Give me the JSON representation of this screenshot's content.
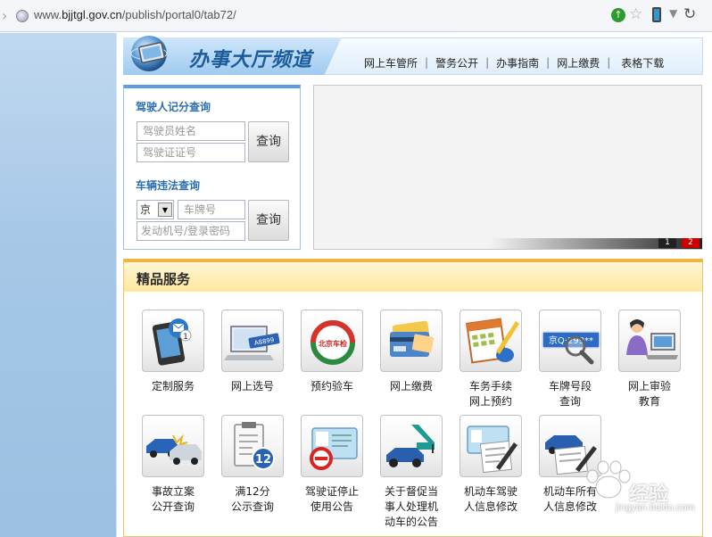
{
  "browser": {
    "url_prefix": "www.",
    "url_domain": "bjjtgl.gov.cn",
    "url_path": "/publish/portal0/tab72/"
  },
  "header": {
    "title": "办事大厅频道",
    "nav": [
      "网上车管所",
      "警务公开",
      "办事指南",
      "网上缴费",
      "表格下载"
    ]
  },
  "driver_query": {
    "title": "驾驶人记分查询",
    "name_placeholder": "驾驶员姓名",
    "license_placeholder": "驾驶证证号",
    "button": "查询"
  },
  "vehicle_query": {
    "title": "车辆违法查询",
    "region_selected": "京",
    "plate_placeholder": "车牌号",
    "engine_placeholder": "发动机号/登录密码",
    "button": "查询"
  },
  "banner": {
    "pages": [
      "1",
      "2"
    ],
    "current_page": 2
  },
  "services": {
    "title": "精品服务",
    "items": [
      {
        "label": "定制服务",
        "icon": "phone-mail-icon"
      },
      {
        "label": "网上选号",
        "icon": "laptop-plate-icon"
      },
      {
        "label": "预约验车",
        "icon": "inspection-stamp-icon"
      },
      {
        "label": "网上缴费",
        "icon": "bank-cards-icon"
      },
      {
        "label": "车务手续\n网上预约",
        "icon": "calendar-pen-icon"
      },
      {
        "label": "车牌号段\n查询",
        "icon": "plate-magnifier-icon",
        "plate_text": "京Q·299**"
      },
      {
        "label": "网上审验\n教育",
        "icon": "person-computer-icon"
      },
      {
        "label": "事故立案\n公开查询",
        "icon": "car-crash-icon"
      },
      {
        "label": "满12分\n公示查询",
        "icon": "clipboard-12-icon",
        "badge": "12"
      },
      {
        "label": "驾驶证停止\n使用公告",
        "icon": "license-stop-icon"
      },
      {
        "label": "关于督促当\n事人处理机\n动车的公告",
        "icon": "tow-crane-icon"
      },
      {
        "label": "机动车驾驶\n人信息修改",
        "icon": "license-edit-icon"
      },
      {
        "label": "机动车所有\n人信息修改",
        "icon": "car-document-icon"
      }
    ]
  },
  "watermark": {
    "brand": "经验",
    "site": "jingyan.baidu.com"
  },
  "colors": {
    "accent_blue": "#2a6fb0",
    "header_blue": "#1d5c9b",
    "service_gold": "#f0b540",
    "active_red": "#cc0000"
  }
}
